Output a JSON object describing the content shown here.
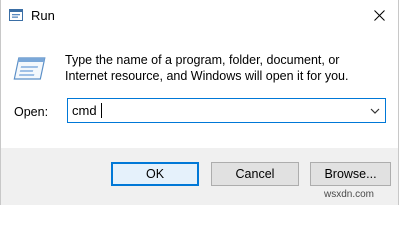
{
  "window": {
    "title": "Run",
    "icon": "run-app-icon",
    "close_icon": "close-icon"
  },
  "content": {
    "description": "Type the name of a program, folder, document, or Internet resource, and Windows will open it for you.",
    "icon": "run-dialog-icon"
  },
  "open": {
    "label": "Open:",
    "value": "cmd",
    "dropdown_icon": "chevron-down-icon"
  },
  "buttons": {
    "ok": "OK",
    "cancel": "Cancel",
    "browse": "Browse..."
  },
  "watermark": "wsxdn.com",
  "colors": {
    "accent": "#0078d7",
    "footer_bg": "#f0f0f0",
    "button_bg": "#e1e1e1"
  }
}
